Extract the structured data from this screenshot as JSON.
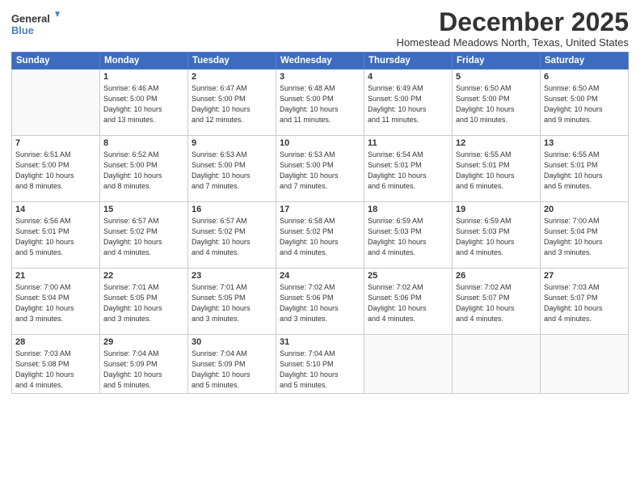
{
  "logo": {
    "line1": "General",
    "line2": "Blue"
  },
  "title": "December 2025",
  "subtitle": "Homestead Meadows North, Texas, United States",
  "days_of_week": [
    "Sunday",
    "Monday",
    "Tuesday",
    "Wednesday",
    "Thursday",
    "Friday",
    "Saturday"
  ],
  "weeks": [
    [
      {
        "day": "",
        "info": ""
      },
      {
        "day": "1",
        "info": "Sunrise: 6:46 AM\nSunset: 5:00 PM\nDaylight: 10 hours\nand 13 minutes."
      },
      {
        "day": "2",
        "info": "Sunrise: 6:47 AM\nSunset: 5:00 PM\nDaylight: 10 hours\nand 12 minutes."
      },
      {
        "day": "3",
        "info": "Sunrise: 6:48 AM\nSunset: 5:00 PM\nDaylight: 10 hours\nand 11 minutes."
      },
      {
        "day": "4",
        "info": "Sunrise: 6:49 AM\nSunset: 5:00 PM\nDaylight: 10 hours\nand 11 minutes."
      },
      {
        "day": "5",
        "info": "Sunrise: 6:50 AM\nSunset: 5:00 PM\nDaylight: 10 hours\nand 10 minutes."
      },
      {
        "day": "6",
        "info": "Sunrise: 6:50 AM\nSunset: 5:00 PM\nDaylight: 10 hours\nand 9 minutes."
      }
    ],
    [
      {
        "day": "7",
        "info": "Sunrise: 6:51 AM\nSunset: 5:00 PM\nDaylight: 10 hours\nand 8 minutes."
      },
      {
        "day": "8",
        "info": "Sunrise: 6:52 AM\nSunset: 5:00 PM\nDaylight: 10 hours\nand 8 minutes."
      },
      {
        "day": "9",
        "info": "Sunrise: 6:53 AM\nSunset: 5:00 PM\nDaylight: 10 hours\nand 7 minutes."
      },
      {
        "day": "10",
        "info": "Sunrise: 6:53 AM\nSunset: 5:00 PM\nDaylight: 10 hours\nand 7 minutes."
      },
      {
        "day": "11",
        "info": "Sunrise: 6:54 AM\nSunset: 5:01 PM\nDaylight: 10 hours\nand 6 minutes."
      },
      {
        "day": "12",
        "info": "Sunrise: 6:55 AM\nSunset: 5:01 PM\nDaylight: 10 hours\nand 6 minutes."
      },
      {
        "day": "13",
        "info": "Sunrise: 6:55 AM\nSunset: 5:01 PM\nDaylight: 10 hours\nand 5 minutes."
      }
    ],
    [
      {
        "day": "14",
        "info": "Sunrise: 6:56 AM\nSunset: 5:01 PM\nDaylight: 10 hours\nand 5 minutes."
      },
      {
        "day": "15",
        "info": "Sunrise: 6:57 AM\nSunset: 5:02 PM\nDaylight: 10 hours\nand 4 minutes."
      },
      {
        "day": "16",
        "info": "Sunrise: 6:57 AM\nSunset: 5:02 PM\nDaylight: 10 hours\nand 4 minutes."
      },
      {
        "day": "17",
        "info": "Sunrise: 6:58 AM\nSunset: 5:02 PM\nDaylight: 10 hours\nand 4 minutes."
      },
      {
        "day": "18",
        "info": "Sunrise: 6:59 AM\nSunset: 5:03 PM\nDaylight: 10 hours\nand 4 minutes."
      },
      {
        "day": "19",
        "info": "Sunrise: 6:59 AM\nSunset: 5:03 PM\nDaylight: 10 hours\nand 4 minutes."
      },
      {
        "day": "20",
        "info": "Sunrise: 7:00 AM\nSunset: 5:04 PM\nDaylight: 10 hours\nand 3 minutes."
      }
    ],
    [
      {
        "day": "21",
        "info": "Sunrise: 7:00 AM\nSunset: 5:04 PM\nDaylight: 10 hours\nand 3 minutes."
      },
      {
        "day": "22",
        "info": "Sunrise: 7:01 AM\nSunset: 5:05 PM\nDaylight: 10 hours\nand 3 minutes."
      },
      {
        "day": "23",
        "info": "Sunrise: 7:01 AM\nSunset: 5:05 PM\nDaylight: 10 hours\nand 3 minutes."
      },
      {
        "day": "24",
        "info": "Sunrise: 7:02 AM\nSunset: 5:06 PM\nDaylight: 10 hours\nand 3 minutes."
      },
      {
        "day": "25",
        "info": "Sunrise: 7:02 AM\nSunset: 5:06 PM\nDaylight: 10 hours\nand 4 minutes."
      },
      {
        "day": "26",
        "info": "Sunrise: 7:02 AM\nSunset: 5:07 PM\nDaylight: 10 hours\nand 4 minutes."
      },
      {
        "day": "27",
        "info": "Sunrise: 7:03 AM\nSunset: 5:07 PM\nDaylight: 10 hours\nand 4 minutes."
      }
    ],
    [
      {
        "day": "28",
        "info": "Sunrise: 7:03 AM\nSunset: 5:08 PM\nDaylight: 10 hours\nand 4 minutes."
      },
      {
        "day": "29",
        "info": "Sunrise: 7:04 AM\nSunset: 5:09 PM\nDaylight: 10 hours\nand 5 minutes."
      },
      {
        "day": "30",
        "info": "Sunrise: 7:04 AM\nSunset: 5:09 PM\nDaylight: 10 hours\nand 5 minutes."
      },
      {
        "day": "31",
        "info": "Sunrise: 7:04 AM\nSunset: 5:10 PM\nDaylight: 10 hours\nand 5 minutes."
      },
      {
        "day": "",
        "info": ""
      },
      {
        "day": "",
        "info": ""
      },
      {
        "day": "",
        "info": ""
      }
    ]
  ]
}
